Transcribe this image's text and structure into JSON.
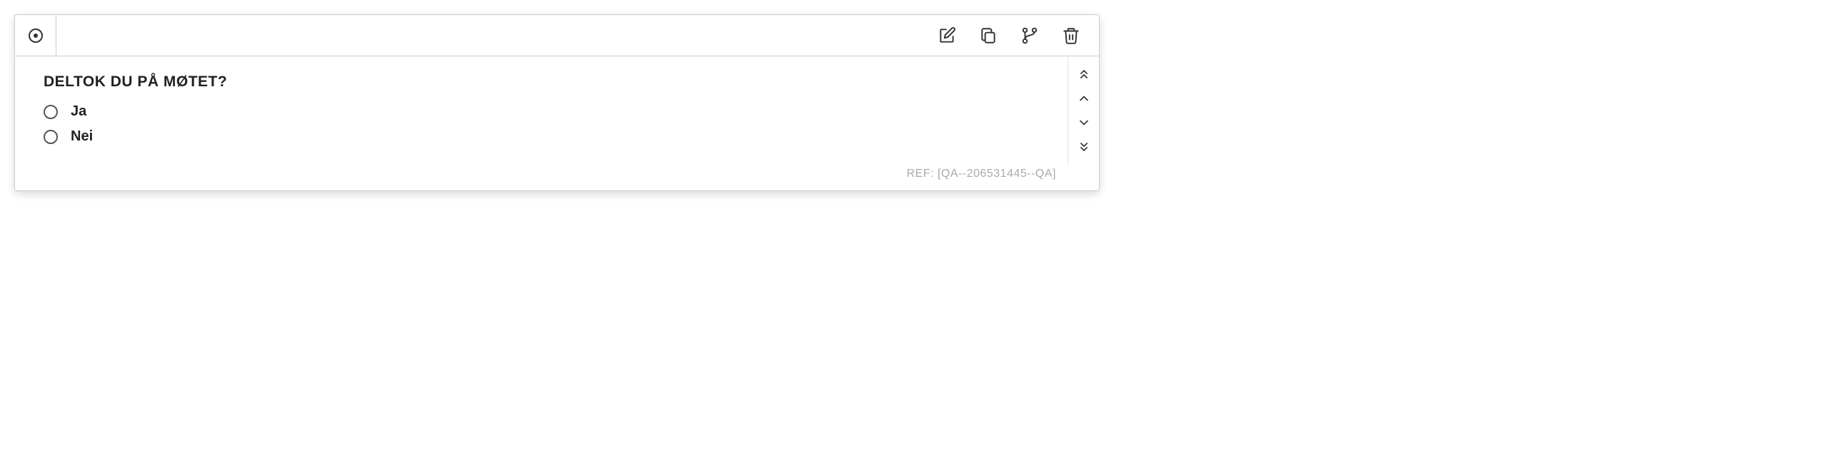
{
  "question": {
    "title": "DELTOK DU PÅ MØTET?",
    "options": [
      {
        "label": "Ja"
      },
      {
        "label": "Nei"
      }
    ],
    "ref_prefix": "REF: ",
    "ref_value": "[QA--206531445--QA]"
  }
}
